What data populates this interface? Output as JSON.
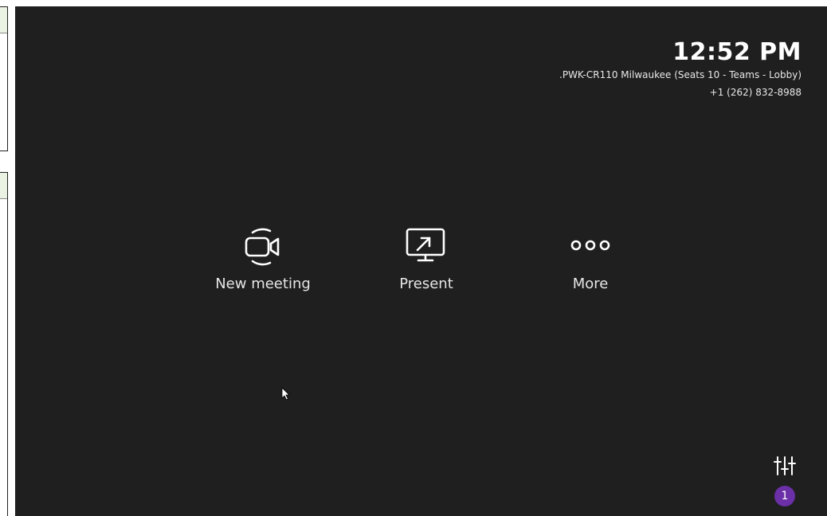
{
  "header": {
    "time": "12:52 PM",
    "room_name": ".PWK-CR110 Milwaukee (Seats 10 - Teams - Lobby)",
    "phone": "+1 (262) 832-8988"
  },
  "actions": [
    {
      "label": "New meeting",
      "icon": "video-camera-icon"
    },
    {
      "label": "Present",
      "icon": "screen-share-icon"
    },
    {
      "label": "More",
      "icon": "ellipsis-icon"
    }
  ],
  "settings": {
    "icon": "sliders-icon",
    "badge_count": "1",
    "badge_color": "#6b2fa8"
  },
  "colors": {
    "background": "#1f1f1f",
    "text": "#ffffff"
  }
}
